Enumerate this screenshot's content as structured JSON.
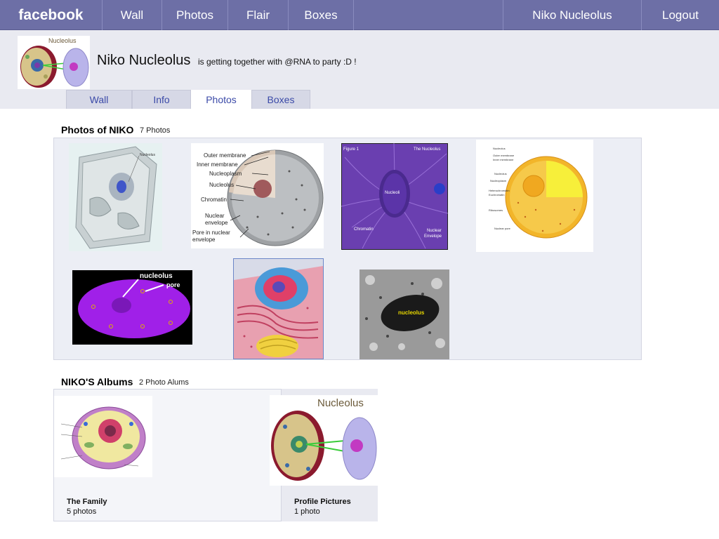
{
  "topbar": {
    "logo": "facebook",
    "nav": [
      "Wall",
      "Photos",
      "Flair",
      "Boxes"
    ],
    "user_name": "Niko Nucleolus",
    "logout": "Logout"
  },
  "profile": {
    "name": "Niko Nucleolus",
    "status": "is getting together with @RNA to party :D !",
    "avatar_label": "Nucleolus"
  },
  "subtabs": [
    "Wall",
    "Info",
    "Photos",
    "Boxes"
  ],
  "photos": {
    "title": "Photos of NIKO",
    "count": "7 Photos",
    "items": [
      {
        "name": "cell-3d",
        "labels": [
          "Nucleolus"
        ]
      },
      {
        "name": "nucleus-diagram",
        "labels": [
          "Outer membrane",
          "Inner membrane",
          "Nucleoplasm",
          "Nucleolus",
          "Chromatin",
          "Nuclear",
          "envelope",
          "Pore in nuclear",
          "envelope"
        ]
      },
      {
        "name": "purple-nucleus",
        "labels": [
          "Figure 1",
          "The Nucleolus",
          "Nucleoli",
          "Chromatin",
          "Nuclear",
          "Envelope"
        ]
      },
      {
        "name": "yellow-nucleus",
        "labels": [
          "Nucleolus",
          "Outer membrane",
          "Inner membrane",
          "Nucleolus",
          "Nucleoplasm",
          "Heterochromatin",
          "Euchromatin",
          "Ribosomes",
          "Nuclear pore"
        ]
      },
      {
        "name": "magenta-nucleus",
        "labels": [
          "nucleolus",
          "pore"
        ]
      },
      {
        "name": "cell-cutaway",
        "labels": []
      },
      {
        "name": "micrograph",
        "labels": [
          "nucleolus"
        ]
      }
    ]
  },
  "albums": {
    "title": "NIKO'S Albums",
    "count": "2 Photo Alums",
    "items": [
      {
        "name": "The Family",
        "count": "5 photos"
      },
      {
        "name": "Profile Pictures",
        "count": "1 photo",
        "cover_label": "Nucleolus"
      }
    ]
  },
  "colors": {
    "topbar": "#6d6fa6",
    "band": "#e9eaf1",
    "link": "#3b4aa8"
  }
}
